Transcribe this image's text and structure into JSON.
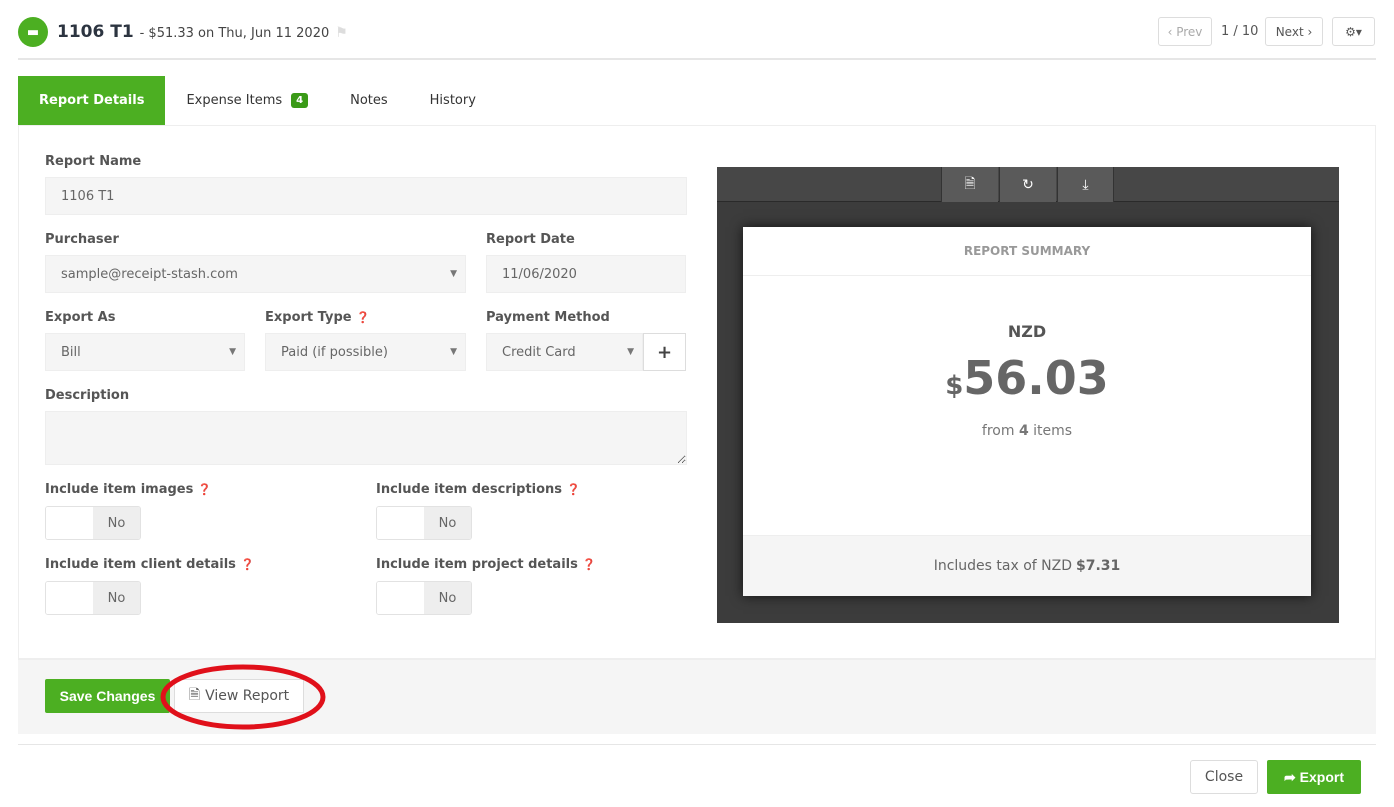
{
  "header": {
    "title": "1106 T1",
    "subtitle": "- $51.33 on Thu, Jun 11 2020",
    "prev": "‹ Prev",
    "page": "1 / 10",
    "next": "Next ›",
    "settings_icon": "gear-icon"
  },
  "tabs": [
    {
      "label": "Report Details",
      "active": true
    },
    {
      "label": "Expense Items",
      "badge": "4"
    },
    {
      "label": "Notes"
    },
    {
      "label": "History"
    }
  ],
  "form": {
    "report_name_label": "Report Name",
    "report_name": "1106 T1",
    "purchaser_label": "Purchaser",
    "purchaser": "sample@receipt-stash.com",
    "report_date_label": "Report Date",
    "report_date": "11/06/2020",
    "export_as_label": "Export As",
    "export_as": "Bill",
    "export_type_label": "Export Type",
    "export_type": "Paid (if possible)",
    "payment_method_label": "Payment Method",
    "payment_method": "Credit Card",
    "description_label": "Description",
    "description": "",
    "toggles": [
      {
        "label": "Include item images",
        "value": "No",
        "on": false
      },
      {
        "label": "Include item descriptions",
        "value": "No",
        "on": false
      },
      {
        "label": "Include item client details",
        "value": "No",
        "on": false
      },
      {
        "label": "Include item project details",
        "value": "No",
        "on": false
      }
    ]
  },
  "summary": {
    "heading": "REPORT SUMMARY",
    "currency": "NZD",
    "symbol": "$",
    "amount": "56.03",
    "from_pre": "from ",
    "count": "4",
    "from_post": " items",
    "tax_pre": "Includes tax of NZD ",
    "tax": "$7.31"
  },
  "actions": {
    "save": "Save Changes",
    "view": "View Report",
    "close": "Close",
    "export": "Export"
  },
  "colors": {
    "accent": "#4caf22",
    "annotation": "#e0101a"
  }
}
